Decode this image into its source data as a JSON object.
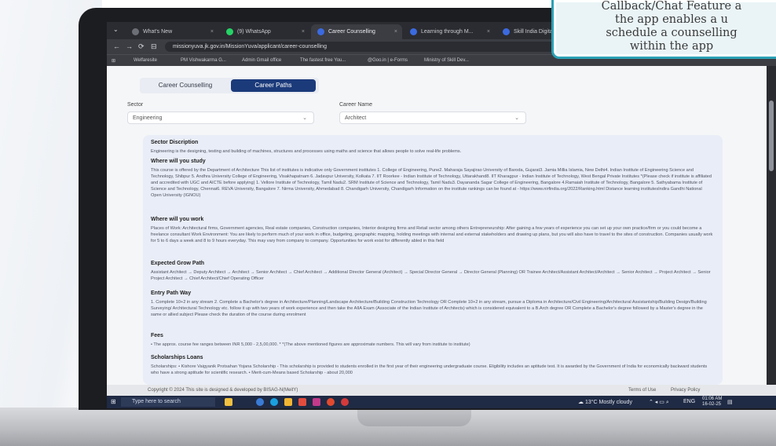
{
  "callout": {
    "lines": [
      "Callback/Chat Feature a",
      "the app enables a u",
      "schedule a counselling",
      "within the app"
    ]
  },
  "browser": {
    "tabs": [
      {
        "label": "What's New",
        "color": "#6d6f77"
      },
      {
        "label": "(9) WhatsApp",
        "color": "#25d366"
      },
      {
        "label": "Career Counselling",
        "color": "#3b6ae0"
      },
      {
        "label": "Learning through M...",
        "color": "#3b6ae0"
      },
      {
        "label": "Skill India Digital H...",
        "color": "#3b6ae0"
      }
    ],
    "url": "missionyuva.jk.gov.in/MissionYuva/applicant/career-counselling",
    "bookmarks": [
      "Welfaresite",
      "PM Vishwakarma G...",
      "Admin Gmail office",
      "The fastest free You...",
      "@Goo.in | e-Forms",
      "Ministry of Skill Dev..."
    ]
  },
  "page": {
    "tab_career_counselling": "Career Counselling",
    "tab_career_paths": "Career Paths",
    "sector_label": "Sector",
    "sector_value": "Engineering",
    "career_label": "Career Name",
    "career_value": "Architect",
    "sections": [
      {
        "title": "Sector Discription",
        "text": "Engineering is the designing, testing and building of machines, structures and processes using maths and science that allows people to solve real-life problems."
      },
      {
        "title": "Where will you study",
        "text": "This course is offered by the Department of Architecture This list of institutes is indicative only Government institutes 1. College of Engineering, Pune2. Maharaja Sayajirao University of Baroda, Gujarat3. Jamia Millia Islamia, New Delhi4. Indian Institute of Engineering Science and Technology, Shibpur 5. Andhra University College of Engineering, Visakhapatnam 6. Jadavpur University, Kolkata 7. IIT Roorkee - Indian Institute of Technology, Uttarakhand8. IIT Kharagpur - Indian Institute of Technology, West Bengal Private Institutes *(Please check if institute is affiliated and accredited with UGC and AICTE before applying) 1. Vellore Institute of Technology, Tamil Nadu2. SRM Institute of Science and Technology, Tamil Nadu3. Dayananda Sagar College of Engineering, Bangalore 4.Ramaiah Institute of Technology, Bangalore 5. Sathyabama Institute of Science and Technology, Chennai6. REVA University, Bangalore 7. Nirma University, Ahmedabad 8. Chandigarh University, Chandigarh Information on the institute rankings can be found at - https://www.nirfindia.org/2022/Ranking.html Distance learning institutesIndira Gandhi National Open University (IGNOU)"
      },
      {
        "title": "Where will you work",
        "text": "Places of Work: Architectural firms, Government agencies, Real estate companies, Construction companies, Interior designing firms and Retail sector among others Entrepreneurship: After gaining a few years of experience you can set up your own practice/firm or you could become a freelance consultant Work Environment: You are likely to perform much of your work in office, budgeting, geographic mapping, holding meetings with internal and external stakeholders and drawing up plans, but you will also have to travel to the sites of construction. Companies usually work for 5 to 6 days a week and 8 to 9 hours everyday. This may vary from company to company. Opportunities for work exist for differently abled in this field"
      },
      {
        "title": "Expected Grow Path",
        "text": "Assistant Architect → Deputy Architect → Architect → Senior Architect → Chief Architect → Additional Director General (Architect) → Special Director General → Director General (Planning) OR Trainee Architect/Assistant Architect/Architect → Senior Architect → Project Architect → Senior Project Architect → Chief Architect/Chief Operating Officer"
      },
      {
        "title": "Entry Path Way",
        "text": "1. Complete 10+2 in any stream 2. Complete a Bachelor's degree in Architecture/Planning/Landscape Architecture/Building Construction Technology OR Complete 10+2 in any stream, pursue a Diploma in Architecture/Civil Engineering/Architectural Assistantship/Building Design/Building Surveying/ Architectural Technology etc. follow it up with two years of work experience and then take the AIIA Exam (Associate of the Indian Institute of Architects) which is considered equivalent to a B.Arch degree OR Complete a Bachelor's degree followed by a Master's degree in the same or allied subject Please check the duration of the course during enrolment"
      },
      {
        "title": "Fees",
        "text": "• The approx. course fee ranges between INR 5,000 - 2,5,00,000. * *(The above mentioned figures are approximate numbers. This will vary from institute to institute)"
      },
      {
        "title": "Scholarships Loans",
        "text": "Scholarships: • Kishore Vaigyanik Protsahan Yojana Scholarship - This scholarship is provided to students enrolled in the first year of their engineering undergraduate course. Eligibility includes an aptitude test. It is awarded by the Government of India for economically backward students who have a strong aptitude for scientific research. • Merit-cum-Means based Scholarship - about 20,000"
      }
    ]
  },
  "footer": {
    "copyright": "Copyright © 2024 This site is designed & developed by BISAG-N(MeitY)",
    "terms": "Terms of Use",
    "privacy": "Privacy Policy"
  },
  "taskbar": {
    "search_placeholder": "Type here to search",
    "weather": "13°C  Mostly cloudy",
    "lang": "ENG",
    "time": "01:06 AM",
    "date": "16-02-25"
  }
}
